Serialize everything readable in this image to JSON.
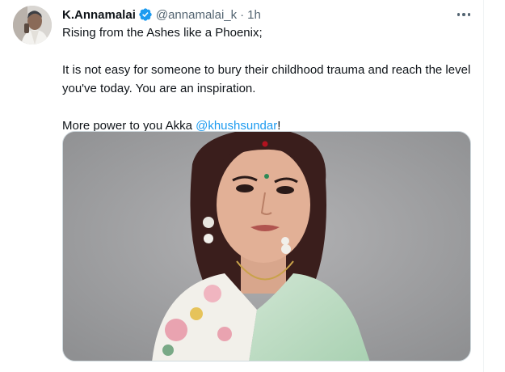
{
  "tweet": {
    "author_name": "K.Annamalai",
    "handle": "@annamalai_k",
    "separator": "·",
    "time": "1h",
    "line1": "Rising from the Ashes like a Phoenix;",
    "line2": "It is not easy for someone to bury their childhood trauma and reach the level you've today. You are an inspiration.",
    "line3_prefix": "More power to you Akka ",
    "mention": "@khushsundar",
    "line3_suffix": "!"
  },
  "icons": {
    "verified": "verified-badge-icon",
    "more": "more-options-icon"
  },
  "colors": {
    "accent": "#1d9bf0",
    "text": "#0f1419",
    "muted": "#536471",
    "border": "#cfd9de"
  }
}
